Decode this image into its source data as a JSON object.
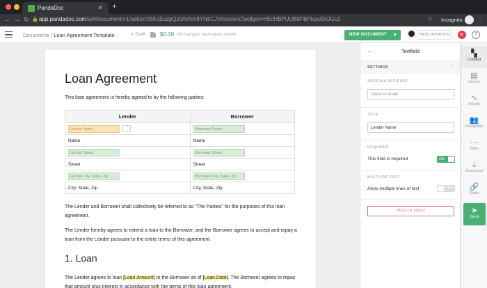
{
  "browser": {
    "tab_title": "PandaDoc",
    "url_host": "app.pandadoc.com",
    "url_path": "/a/#/document/v1/editor/X5KsEazpQz9AHVc8YN6CJV/content?widget=HEcHBPUUB8FBPkpaSkUGc2",
    "incognito_label": "Incognito"
  },
  "appbar": {
    "crumb_root": "Documents",
    "crumb_sep": "/",
    "doc_name": "Loan Agreement Template",
    "status": "Draft",
    "price": "$0.00",
    "saved": "All changes have been saved",
    "new_doc": "NEW DOCUMENT",
    "updates": "NEW UPDATES!",
    "avatar": "AL",
    "help": "?"
  },
  "doc": {
    "title": "Loan Agreement",
    "intro": "This loan agreement is hereby agreed to by the following parties:",
    "table": {
      "headers": [
        "Lender",
        "Borrower"
      ],
      "rows": [
        {
          "l": "Lender Name",
          "r": "Borrower Name",
          "field": true
        },
        {
          "l": "Name",
          "r": "Name",
          "field": false
        },
        {
          "l": "Lender Street",
          "r": "Borrower Street",
          "field": true
        },
        {
          "l": "Street",
          "r": "Street",
          "field": false
        },
        {
          "l": "Lender City, State, Zip",
          "r": "Borrower City, State, Zip",
          "field": true
        },
        {
          "l": "City, State, Zip",
          "r": "City, State, Zip",
          "field": false
        }
      ]
    },
    "p1": "The Lender and Borrower shall collectively be referred to as \"The Parties\" for the purposes of this loan agreement.",
    "p2": "The Lender hereby agrees to extend a loan to the Borrower, and the Borrower agrees to accept and repay a loan from the Lender pursuant to the entire terms of this agreement.",
    "section": "1. Loan",
    "p3_a": "The Lender agrees to loan ",
    "p3_var1": "[Loan.Amount]",
    "p3_b": " to the Borrower as of ",
    "p3_var2": "[Loan.Date]",
    "p3_c": ". The Borrower agrees to repay that amount plus interest in accordance with the terms of this loan agreement."
  },
  "panel": {
    "title": "Textfield",
    "settings": "SETTINGS",
    "assign_label": "ASSIGN A RECIPIENT",
    "assign_placeholder": "Name or email",
    "title_label": "TITLE",
    "title_value": "Lender Name",
    "required_label": "REQUIRED",
    "required_text": "This field is required",
    "required_toggle": "ON",
    "multiline_label": "MULTILINE TEXT",
    "multiline_text": "Allow multiple lines of text",
    "multiline_toggle": "OFF",
    "delete": "DELETE FIELD"
  },
  "rail": [
    {
      "label": "Content",
      "icon": "content-icon",
      "glyph": "▚"
    },
    {
      "label": "Library",
      "icon": "library-icon",
      "glyph": "▤"
    },
    {
      "label": "Activity",
      "icon": "activity-icon",
      "glyph": "∿"
    },
    {
      "label": "Recipients",
      "icon": "recipients-icon",
      "glyph": "👥"
    },
    {
      "label": "More",
      "icon": "more-icon",
      "glyph": "⋯"
    },
    {
      "label": "Download",
      "icon": "download-icon",
      "glyph": "⤓"
    },
    {
      "label": "Share",
      "icon": "share-icon",
      "glyph": "🔗"
    },
    {
      "label": "Send",
      "icon": "send-icon",
      "glyph": "➤"
    }
  ],
  "colors": {
    "accent": "#47b072",
    "danger": "#e57373",
    "highlight": "#fbf3a0"
  }
}
